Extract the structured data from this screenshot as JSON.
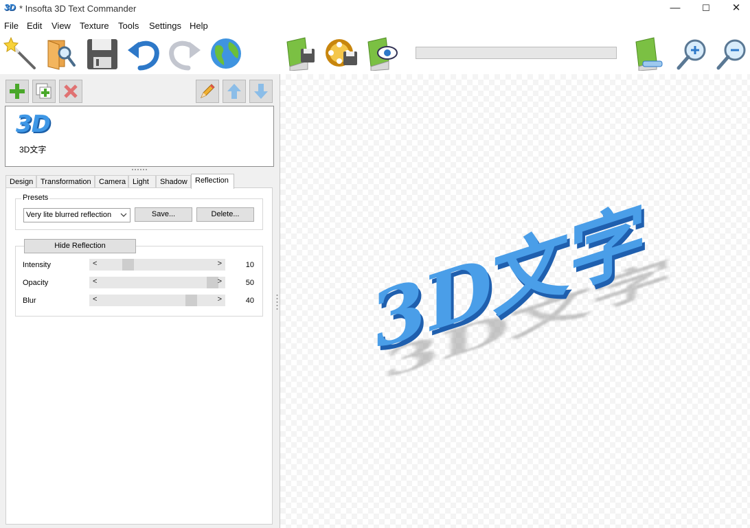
{
  "window": {
    "app_icon_text": "3D",
    "title": "* Insofta 3D Text Commander",
    "minimize": "—",
    "maximize": "☐",
    "close": "✕"
  },
  "menu": [
    "File",
    "Edit",
    "View",
    "Texture",
    "Tools",
    "Settings",
    "Help"
  ],
  "toolbar": {
    "icons": [
      "wizard-icon",
      "open-icon",
      "save-icon",
      "undo-icon",
      "redo-icon",
      "web-icon",
      "save-image-icon",
      "save-animation-icon",
      "preview-icon",
      "image-size-icon",
      "zoom-in-icon",
      "zoom-out-icon"
    ]
  },
  "object_toolbar": {
    "icons": [
      "add-icon",
      "duplicate-icon",
      "delete-icon",
      "edit-icon",
      "move-up-icon",
      "move-down-icon"
    ]
  },
  "objects": [
    {
      "thumb": "3D",
      "label": "3D文字"
    }
  ],
  "tabs": [
    "Design",
    "Transformation",
    "Camera",
    "Light",
    "Shadow",
    "Reflection"
  ],
  "active_tab": "Reflection",
  "presets": {
    "group_label": "Presets",
    "selected": "Very lite blurred reflection",
    "save_label": "Save...",
    "delete_label": "Delete..."
  },
  "reflection": {
    "toggle_label": "Hide Reflection",
    "sliders": [
      {
        "label": "Intensity",
        "value": "10",
        "fraction": 0.1
      },
      {
        "label": "Opacity",
        "value": "50",
        "fraction": 0.5
      },
      {
        "label": "Blur",
        "value": "40",
        "fraction": 0.4
      }
    ],
    "left_arrow": "<",
    "right_arrow": ">"
  },
  "canvas_text": "3D文字",
  "colors": {
    "text_face": "#4a9ee8",
    "text_side": "#1f5fae",
    "shadow": "#9a9a9a"
  }
}
